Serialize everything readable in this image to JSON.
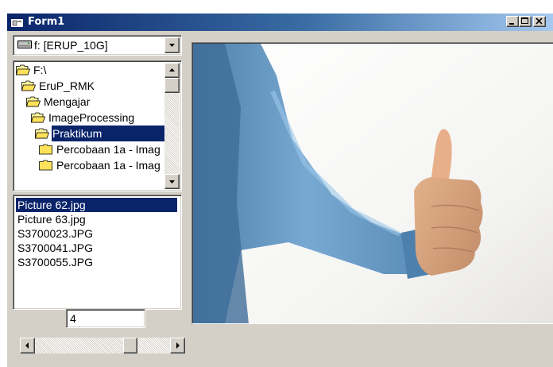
{
  "window": {
    "title": "Form1",
    "controls": [
      "minimize-icon",
      "maximize-icon",
      "close-icon"
    ]
  },
  "drive": {
    "label": "f: [ERUP_10G]",
    "icon": "hard-drive-icon"
  },
  "directories": [
    {
      "label": "F:\\",
      "icon": "open-folder-icon",
      "selected": false
    },
    {
      "label": "EruP_RMK",
      "icon": "open-folder-icon",
      "selected": false
    },
    {
      "label": "Mengajar",
      "icon": "open-folder-icon",
      "selected": false
    },
    {
      "label": "ImageProcessing",
      "icon": "open-folder-icon",
      "selected": false
    },
    {
      "label": "Praktikum",
      "icon": "open-folder-icon",
      "selected": true
    },
    {
      "label": "Percobaan 1a - Imag",
      "icon": "folder-icon",
      "selected": false
    },
    {
      "label": "Percobaan 1a - Imag",
      "icon": "folder-icon",
      "selected": false
    }
  ],
  "files": [
    {
      "name": "Picture 62.jpg",
      "selected": true
    },
    {
      "name": "Picture 63.jpg",
      "selected": false
    },
    {
      "name": "S3700023.JPG",
      "selected": false
    },
    {
      "name": "S3700041.JPG",
      "selected": false
    },
    {
      "name": "S3700055.JPG",
      "selected": false
    }
  ],
  "value_input": "4",
  "slider": {
    "position_fraction": 0.73
  },
  "picture": {
    "subject": "arm-thumbs-up-photo"
  },
  "colors": {
    "selection": "#0a246a",
    "face": "#d4d0c8",
    "title_gradient_start": "#0a246a",
    "title_gradient_end": "#a6caf0"
  }
}
